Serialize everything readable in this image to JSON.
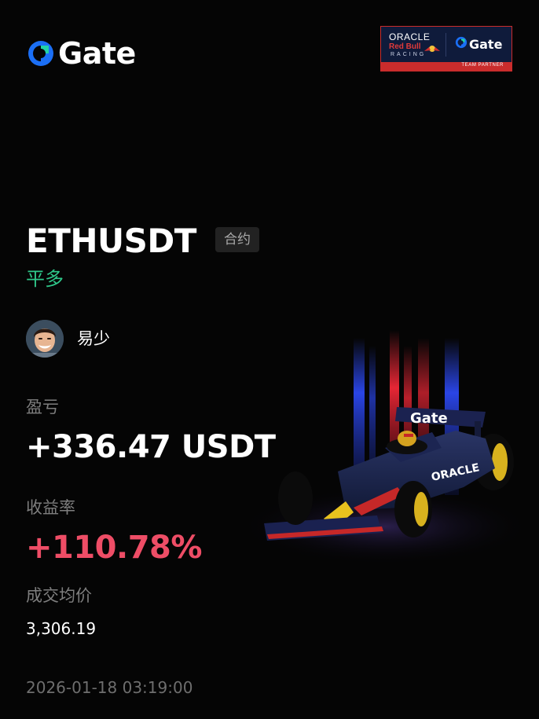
{
  "brand": {
    "name": "Gate",
    "logo_icon": "gate-logo-icon",
    "accent": "#1b6ff5",
    "accent_secondary": "#22d3a6"
  },
  "partner_badge": {
    "line1": "ORACLE",
    "line2": "Red Bull",
    "line3": "RACING",
    "partner_brand": "Gate",
    "strip_label": "TEAM PARTNER",
    "border_color": "#c92c2c",
    "background": "#0f1b3b"
  },
  "position": {
    "pair": "ETHUSDT",
    "contract_type": "合约",
    "side": "平多",
    "side_color": "#2fc88a"
  },
  "user": {
    "name": "易少",
    "avatar_icon": "avatar-photo"
  },
  "stats": {
    "pnl_label": "盈亏",
    "pnl_value": "+336.47 USDT",
    "rate_label": "收益率",
    "rate_value": "+110.78%",
    "rate_color": "#ee4d66",
    "price_label": "成交均价",
    "price_value": "3,306.19"
  },
  "footer": {
    "timestamp": "2026-01-18 03:19:00"
  },
  "hero": {
    "car_wing_text": "Gate",
    "car_sidepod_text": "ORACLE"
  }
}
